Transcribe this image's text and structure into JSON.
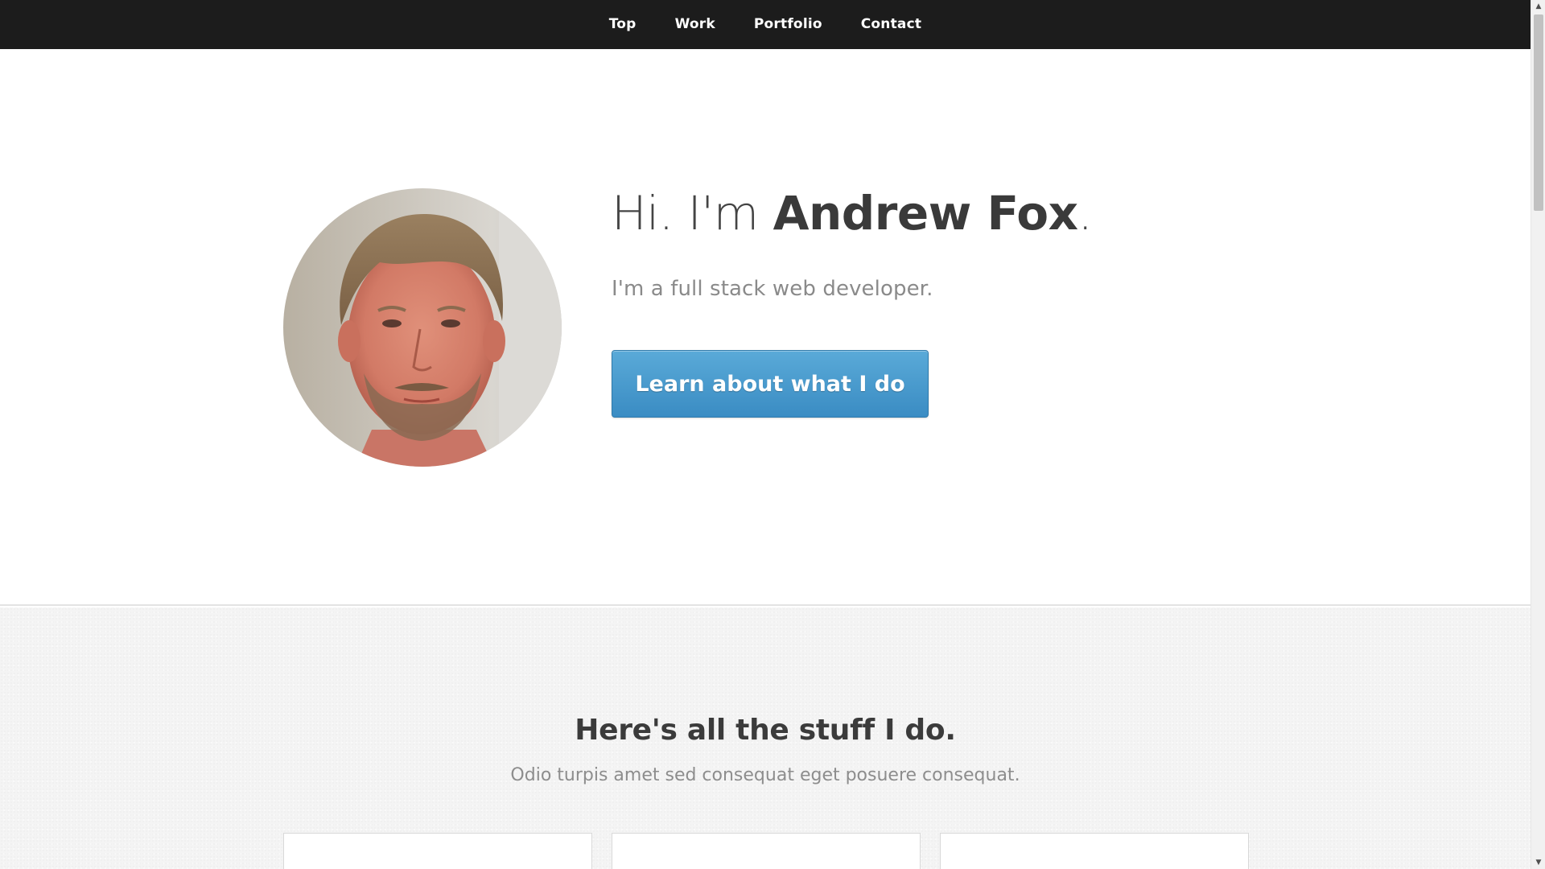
{
  "nav": {
    "items": [
      {
        "label": "Top"
      },
      {
        "label": "Work"
      },
      {
        "label": "Portfolio"
      },
      {
        "label": "Contact"
      }
    ]
  },
  "hero": {
    "greeting": "Hi. I'm ",
    "name": "Andrew Fox",
    "period": ".",
    "subtitle": "I'm a full stack web developer.",
    "cta_label": "Learn about what I do",
    "avatar_icon": "profile-photo"
  },
  "work": {
    "title": "Here's all the stuff I do.",
    "subtitle": "Odio turpis amet sed consequat eget posuere consequat."
  },
  "colors": {
    "nav_bg": "#1c1c1c",
    "cta": "#3f93c9",
    "section_bg": "#f4f4f4"
  },
  "scrollbar": {
    "up_icon": "chevron-up-icon",
    "down_icon": "chevron-down-icon"
  }
}
